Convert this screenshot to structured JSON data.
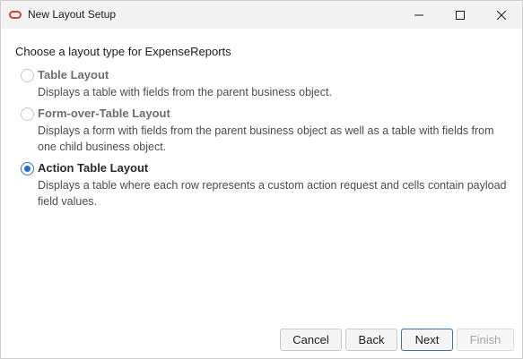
{
  "window": {
    "title": "New Layout Setup"
  },
  "prompt": "Choose a layout type for ExpenseReports",
  "options": [
    {
      "label": "Table Layout",
      "description": "Displays a table with fields from the parent business object.",
      "selected": false
    },
    {
      "label": "Form-over-Table Layout",
      "description": "Displays a form with fields from the parent business object as well as a table with fields from one child business object.",
      "selected": false
    },
    {
      "label": "Action Table Layout",
      "description": "Displays a table where each row represents a custom action request and cells contain payload field values.",
      "selected": true
    }
  ],
  "buttons": {
    "cancel": "Cancel",
    "back": "Back",
    "next": "Next",
    "finish": "Finish"
  },
  "icons": {
    "app": "oracle-logo-icon",
    "minimize": "minimize-icon",
    "maximize": "maximize-icon",
    "close": "close-icon"
  },
  "colors": {
    "accent": "#1f6fd6",
    "brand": "#c74634"
  }
}
